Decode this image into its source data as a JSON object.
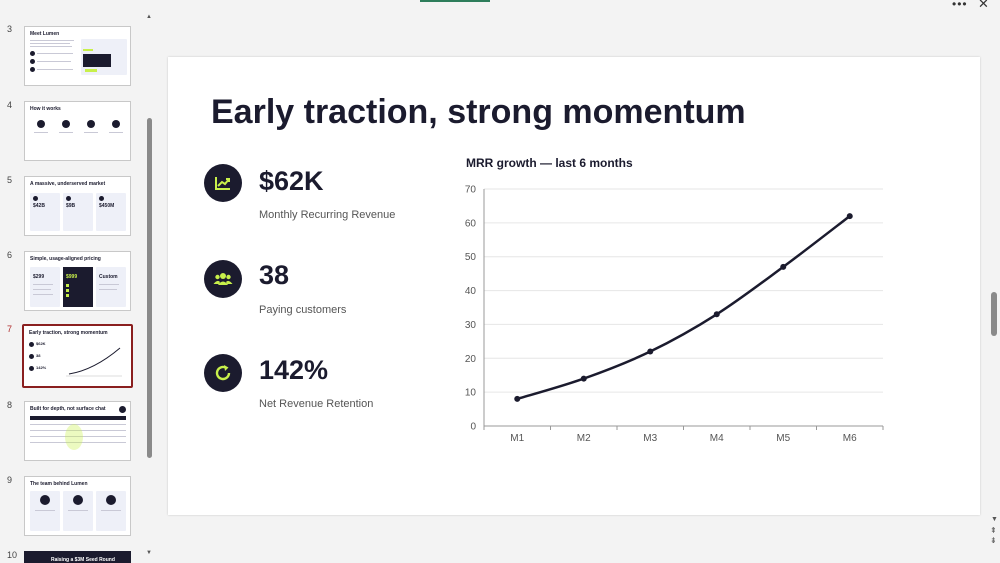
{
  "window": {
    "more_glyph": "•••",
    "close_glyph": "✕"
  },
  "thumbnails": [
    {
      "number": "3",
      "title": "Meet Lumen"
    },
    {
      "number": "4",
      "title": "How it works"
    },
    {
      "number": "5",
      "title": "A massive, underserved market",
      "stats": [
        "$42B",
        "$9B",
        "$450M"
      ]
    },
    {
      "number": "6",
      "title": "Simple, usage-aligned pricing",
      "stats": [
        "$299",
        "$999",
        "Custom"
      ]
    },
    {
      "number": "7",
      "title": "Early traction, strong momentum",
      "stats": [
        "$62K",
        "38",
        "142%"
      ],
      "active": true
    },
    {
      "number": "8",
      "title": "Built for depth, not surface chat"
    },
    {
      "number": "9",
      "title": "The team behind Lumen"
    },
    {
      "number": "10",
      "title": "Raising a $3M Seed Round"
    }
  ],
  "slide": {
    "title": "Early traction, strong momentum",
    "metrics": [
      {
        "value": "$62K",
        "label": "Monthly Recurring Revenue",
        "icon": "trending-up-icon"
      },
      {
        "value": "38",
        "label": "Paying customers",
        "icon": "users-icon"
      },
      {
        "value": "142%",
        "label": "Net Revenue Retention",
        "icon": "refresh-icon"
      }
    ]
  },
  "colors": {
    "navy": "#1b1b2e",
    "lime": "#c8f04b",
    "active_border": "#8a1f1f"
  },
  "chart_data": {
    "type": "line",
    "title": "MRR growth — last 6 months",
    "categories": [
      "M1",
      "M2",
      "M3",
      "M4",
      "M5",
      "M6"
    ],
    "series": [
      {
        "values": [
          8,
          14,
          22,
          33,
          47,
          62
        ]
      }
    ],
    "ylim": [
      0,
      70
    ],
    "yticks": [
      0,
      10,
      20,
      30,
      40,
      50,
      60,
      70
    ],
    "grid": true,
    "xlabel": "",
    "ylabel": ""
  }
}
